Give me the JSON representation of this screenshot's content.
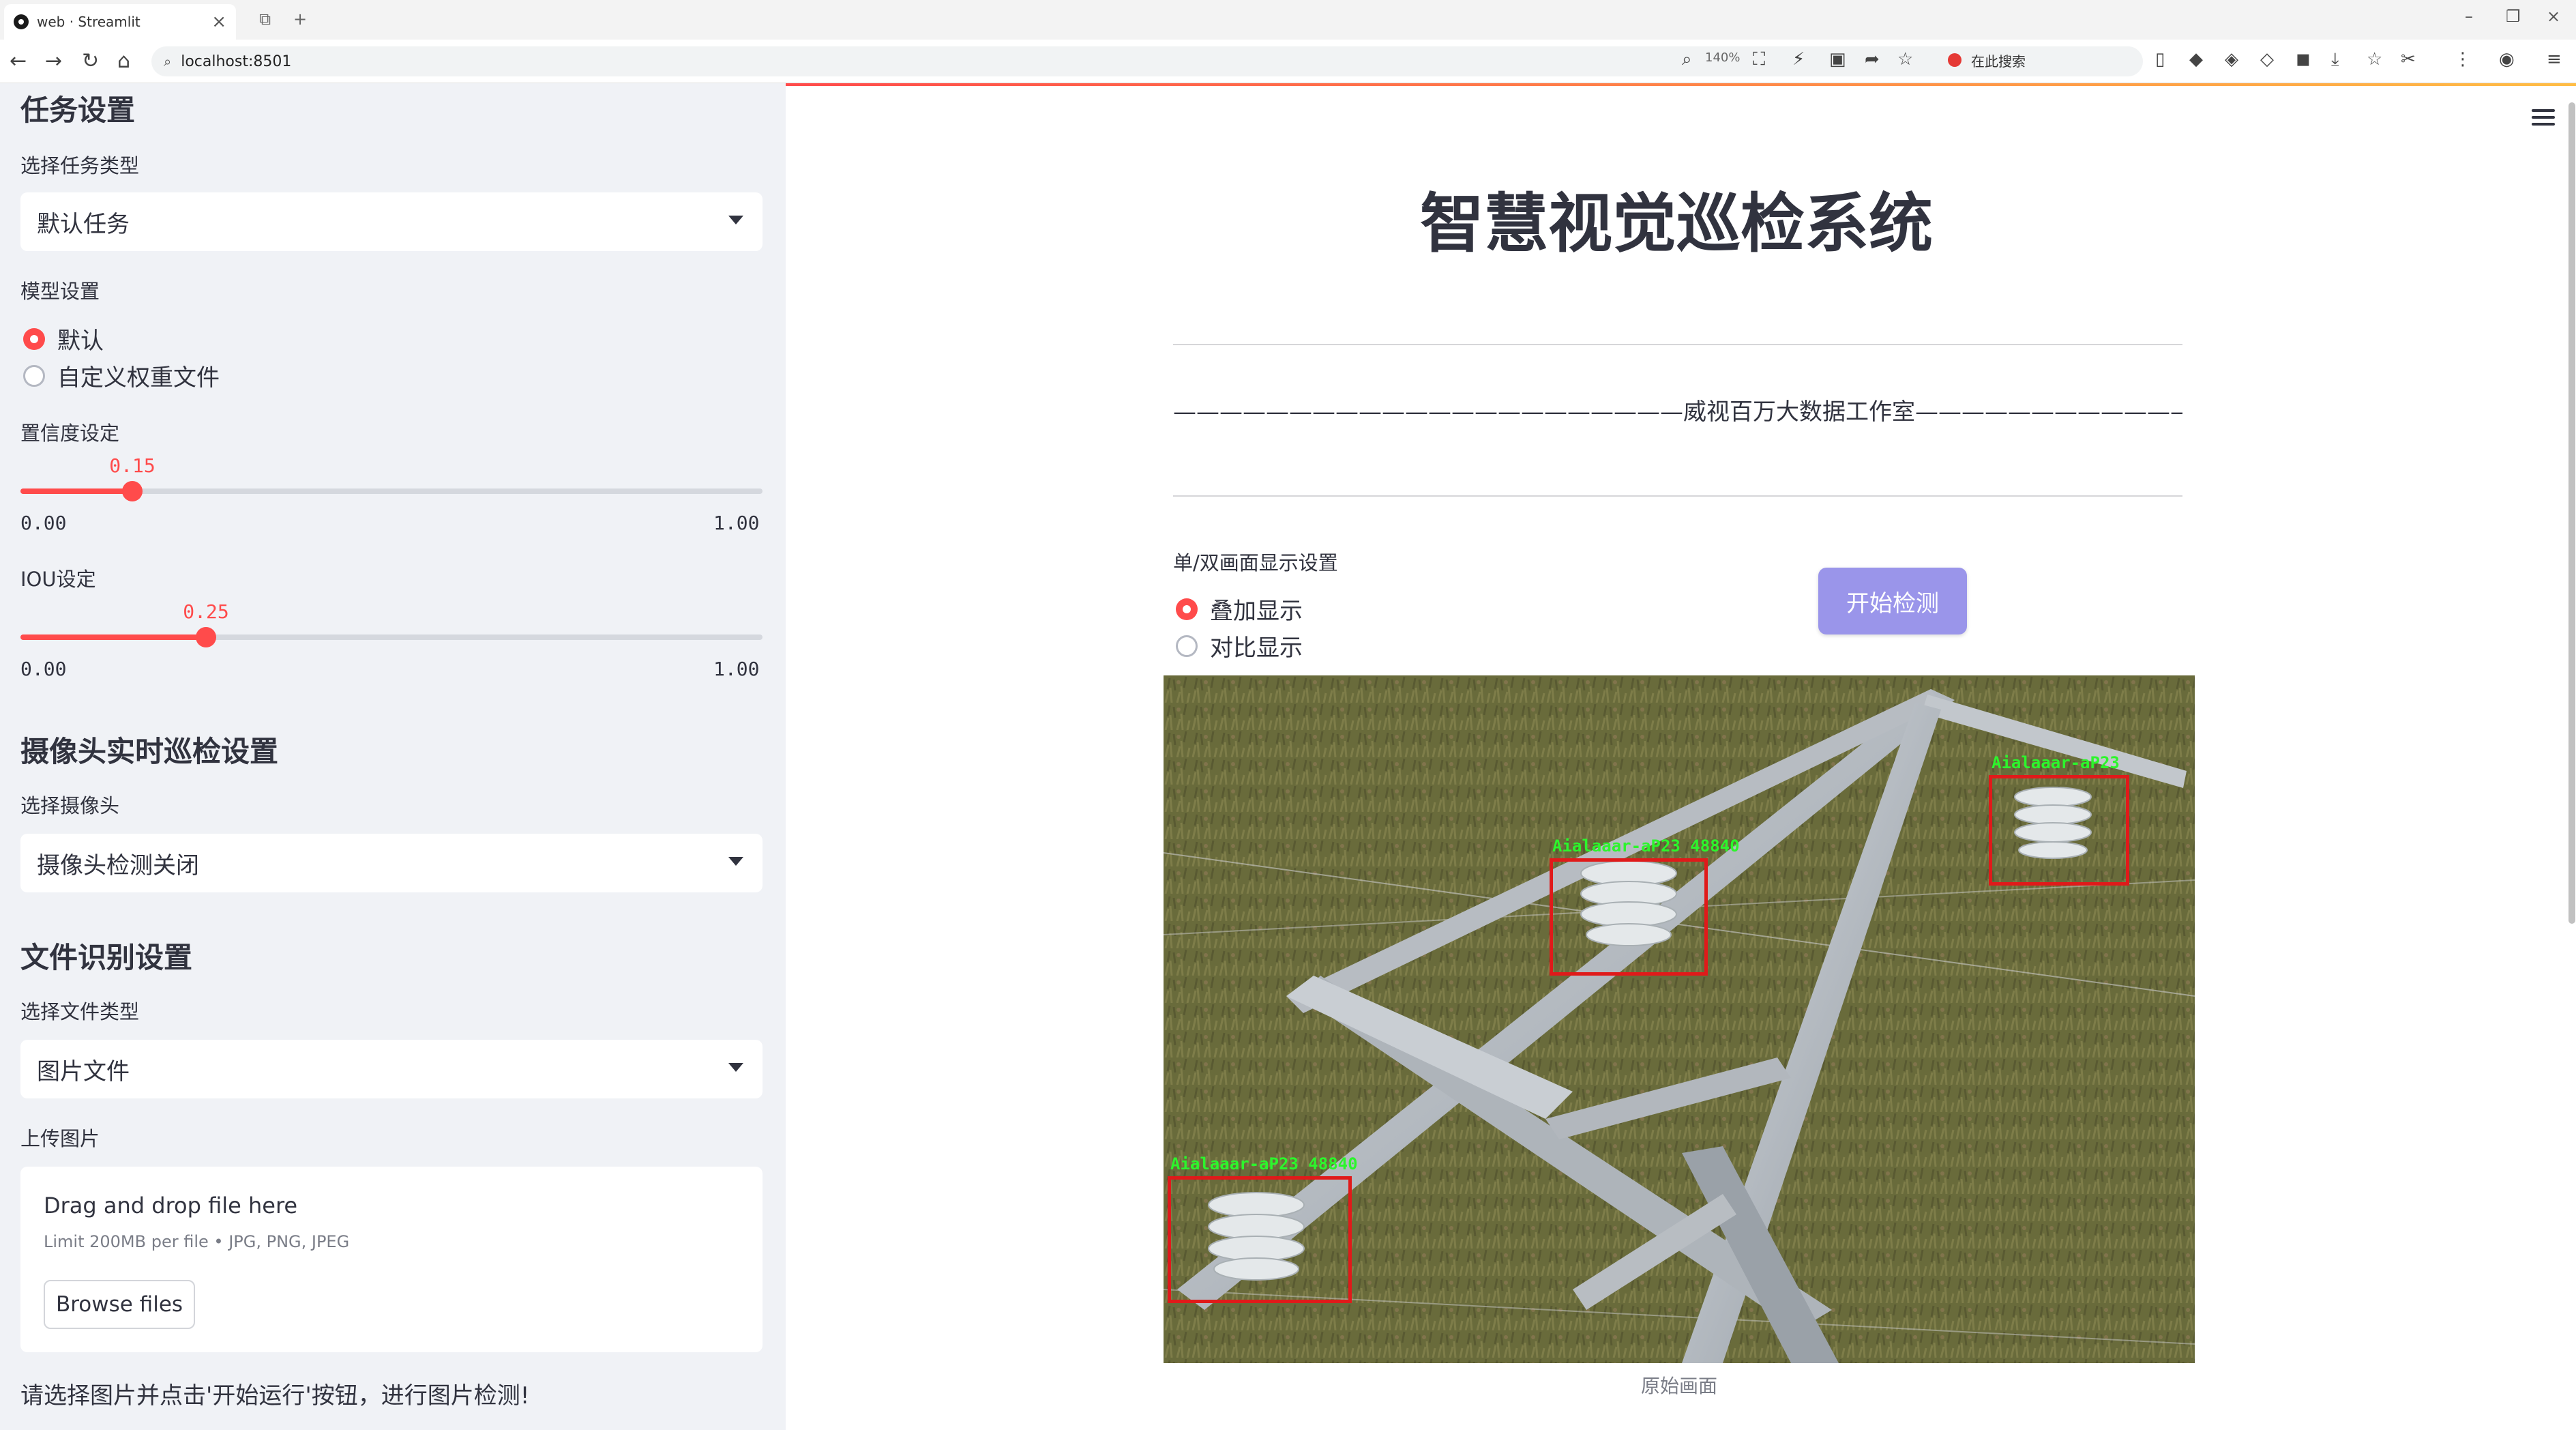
{
  "browser": {
    "tab_title": "web · Streamlit",
    "url": "localhost:8501",
    "zoom": "140%",
    "search_placeholder": "在此搜索"
  },
  "sidebar": {
    "task_section_title": "任务设置",
    "task_type_label": "选择任务类型",
    "task_type_value": "默认任务",
    "model_label": "模型设置",
    "model_options": [
      "默认",
      "自定义权重文件"
    ],
    "model_selected": "默认",
    "confidence_label": "置信度设定",
    "confidence_value": "0.15",
    "confidence_min": "0.00",
    "confidence_max": "1.00",
    "iou_label": "IOU设定",
    "iou_value": "0.25",
    "iou_min": "0.00",
    "iou_max": "1.00",
    "camera_section_title": "摄像头实时巡检设置",
    "camera_label": "选择摄像头",
    "camera_value": "摄像头检测关闭",
    "file_section_title": "文件识别设置",
    "file_type_label": "选择文件类型",
    "file_type_value": "图片文件",
    "upload_label": "上传图片",
    "upload_title": "Drag and drop file here",
    "upload_limit": "Limit 200MB per file • JPG, PNG, JPEG",
    "browse_label": "Browse files",
    "footer_hint": "请选择图片并点击'开始运行'按钮，进行图片检测!"
  },
  "main": {
    "title": "智慧视觉巡检系统",
    "subtitle": "——————————————————————威视百万大数据工作室———————————————————————",
    "display_label": "单/双画面显示设置",
    "display_options": [
      "叠加显示",
      "对比显示"
    ],
    "display_selected": "叠加显示",
    "start_button": "开始检测",
    "image_caption": "原始画面",
    "detections": [
      {
        "label": "Aialaaar-aP23 48840"
      },
      {
        "label": "Aialaaar-aP23"
      },
      {
        "label": "Aialaaar-aP23 48840"
      }
    ]
  }
}
